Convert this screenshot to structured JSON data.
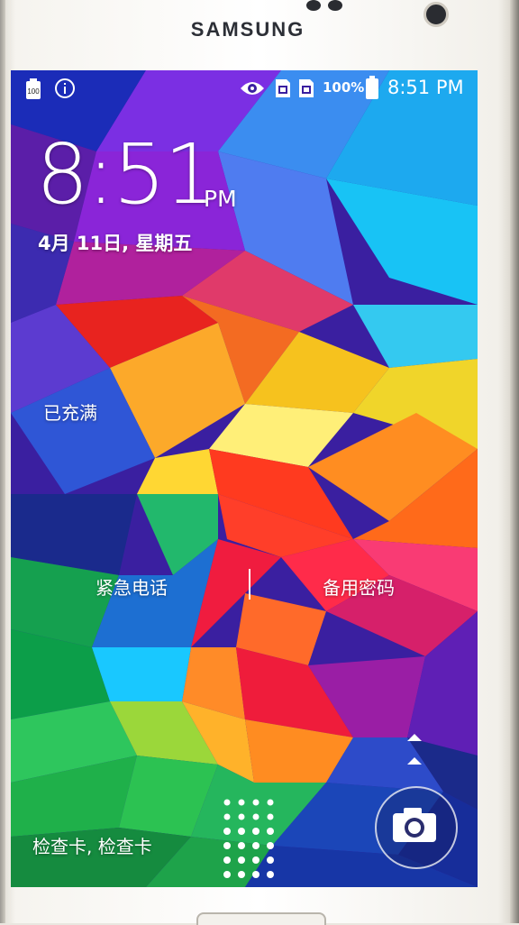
{
  "device": {
    "brand": "SAMSUNG"
  },
  "status_bar": {
    "battery_icon_level": "100",
    "info_icon": "info-icon",
    "eye_icon": "smart-stay-eye-icon",
    "sim_icons": [
      "sim1-icon",
      "sim2-icon"
    ],
    "battery_percent": "100%",
    "time": "8:51 PM"
  },
  "lockscreen": {
    "time": "8:51",
    "ampm": "PM",
    "date": "4月 11日, 星期五",
    "charge_status": "已充满",
    "emergency_call_label": "紧急电话",
    "backup_password_label": "备用密码",
    "carrier_label": "检查卡, 检查卡",
    "camera_icon": "camera-icon",
    "unlock_hint_icon": "chevron-up-icon",
    "unlock_pattern_icon": "unlock-dots-icon"
  },
  "colors": {
    "text": "#ffffff",
    "wallpaper_primary": [
      "#7a2ee0",
      "#ff2a2a",
      "#ffd21e",
      "#1ec3ff",
      "#18c25a"
    ]
  }
}
